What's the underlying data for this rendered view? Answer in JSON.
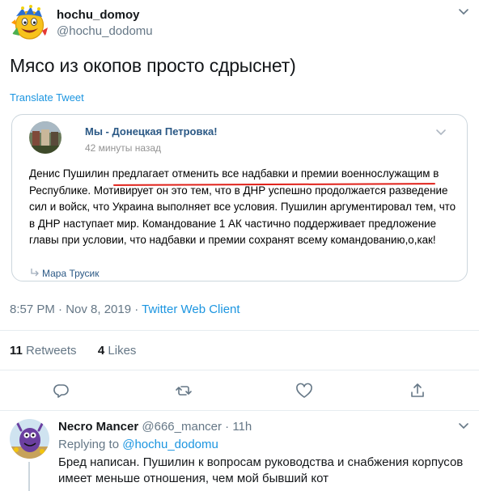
{
  "tweet": {
    "display_name": "hochu_domoy",
    "handle": "@hochu_dodomu",
    "text": "Мясо из окопов просто сдрыснет)",
    "translate_label": "Translate Tweet",
    "timestamp": "8:57 PM · Nov 8, 2019 · ",
    "client": "Twitter Web Client",
    "retweets_count": "11",
    "retweets_label": " Retweets",
    "likes_count": "4",
    "likes_label": " Likes"
  },
  "quoted_post": {
    "group_name": "Мы - Донецкая Петровка!",
    "time_ago": "42 минуты назад",
    "text": "Денис Пушилин предлагает отменить все надбавки и премии военнослужащим в Республике. Мотивирует он это тем, что в ДНР успешно продолжается разведение сил и войск, что Украина выполняет все условия. Пушилин аргументировал тем, что в ДНР наступает мир. Командование 1 АК частично поддерживает предложение главы при условии, что надбавки и премии сохранят всему командованию,о,как!",
    "author": "Мара Трусик"
  },
  "reply": {
    "display_name": "Necro Mancer",
    "handle_time": " @666_mancer · 11h",
    "replying_prefix": "Replying to ",
    "replying_mention": "@hochu_dodomu",
    "text": "Бред написан. Пушилин к вопросам руководства и снабжения корпусов имеет меньше отношения, чем мой бывший кот"
  },
  "actions": {
    "icons": [
      "reply-icon",
      "retweet-icon",
      "like-icon",
      "share-icon"
    ]
  },
  "colors": {
    "link_blue": "#1b95e0",
    "vk_blue": "#2a5885",
    "underline_red": "#e0211a",
    "muted": "#657786"
  }
}
